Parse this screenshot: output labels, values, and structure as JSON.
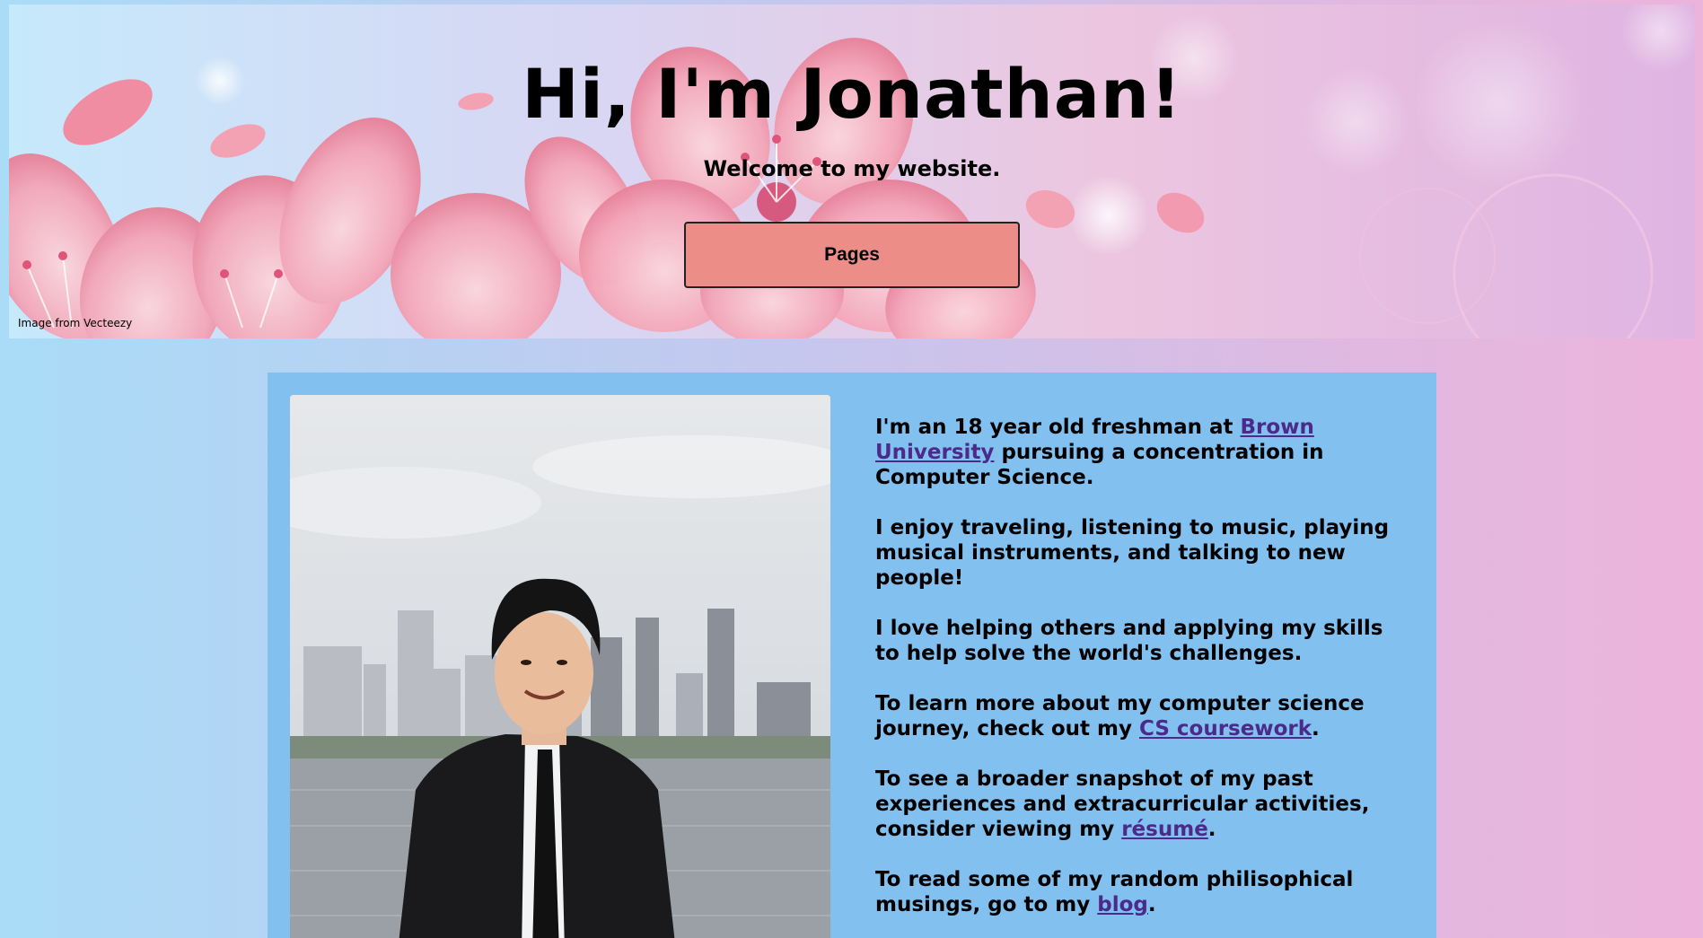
{
  "hero": {
    "title": "Hi, I'm Jonathan!",
    "subtitle": "Welcome to my website.",
    "pages_button": "Pages",
    "credit": "Image from Vecteezy"
  },
  "bio": {
    "p1_before": "I'm an 18 year old freshman at ",
    "p1_link": "Brown University",
    "p1_after": " pursuing a concentration in Computer Science.",
    "p2": "I enjoy traveling, listening to music, playing musical instruments, and talking to new people!",
    "p3": "I love helping others and applying my skills to help solve the world's challenges.",
    "p4_before": "To learn more about my computer science journey, check out my ",
    "p4_link": "CS coursework",
    "p4_after": ".",
    "p5_before": "To see a broader snapshot of my past experiences and extracurricular activities, consider viewing my ",
    "p5_link": "résumé",
    "p5_after": ".",
    "p6_before": "To read some of my random philisophical musings, go to my ",
    "p6_link": "blog",
    "p6_after": "."
  },
  "colors": {
    "button": "#ec8d88",
    "content_box": "#82c0f0",
    "link": "#4b2a8a"
  }
}
